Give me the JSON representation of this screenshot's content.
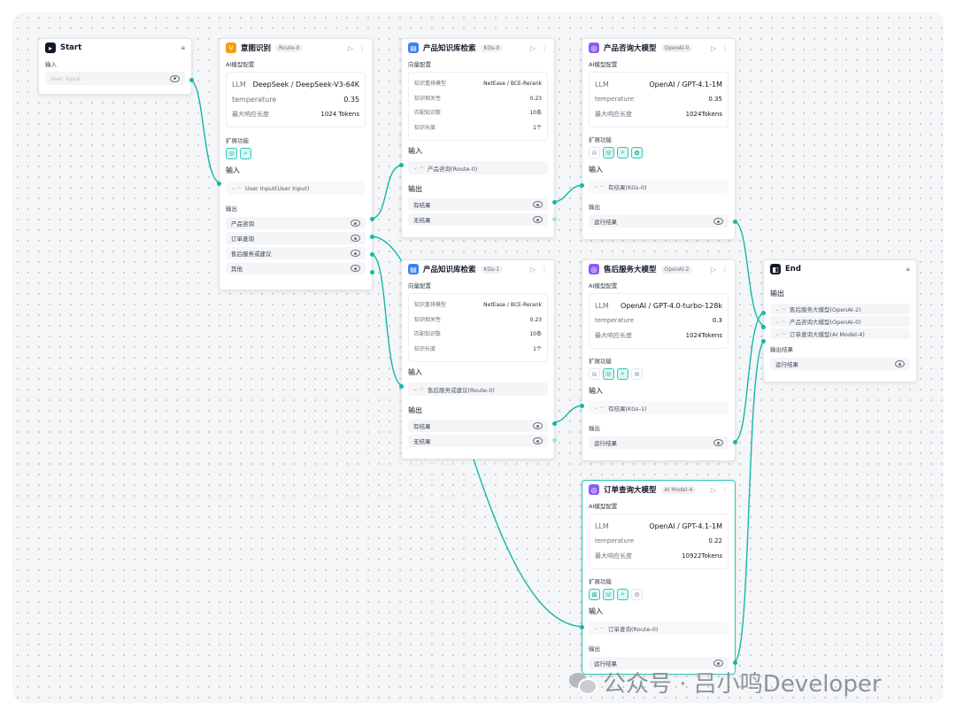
{
  "nodes": {
    "start": {
      "title": "Start",
      "input_label": "输入",
      "input_placeholder": "User Input"
    },
    "route": {
      "title": "意图识别",
      "badge": "Route-0",
      "config_label": "AI模型配置",
      "llm_label": "LLM",
      "llm_value": "DeepSeek / DeepSeek-V3-64K",
      "temp_label": "temperature",
      "temp_value": "0.35",
      "maxlen_label": "最大响应长度",
      "maxlen_value": "1024 Tokens",
      "ext_label": "扩展功能",
      "input_label": "输入",
      "input_value": "User Input(User Input)",
      "output_label": "输出",
      "outputs": [
        "产品咨询",
        "订单查询",
        "售后服务或建议",
        "其他"
      ]
    },
    "kb0": {
      "title": "产品知识库检索",
      "badge": "KGs-0",
      "config_label": "向量配置",
      "rows": [
        [
          "知识重排模型",
          "NetEase / BCE-Rerank"
        ],
        [
          "知识相关性",
          "0.23"
        ],
        [
          "匹配知识数",
          "10条"
        ],
        [
          "知识长度",
          "1个"
        ]
      ],
      "input_label": "输入",
      "input_value": "产品咨询(Route-0)",
      "output_label": "输出",
      "outputs": [
        "有结果",
        "无结果"
      ]
    },
    "kb1": {
      "title": "产品知识库检索",
      "badge": "KGs-1",
      "config_label": "向量配置",
      "rows": [
        [
          "知识重排模型",
          "NetEase / BCE-Rerank"
        ],
        [
          "知识相关性",
          "0.23"
        ],
        [
          "匹配知识数",
          "10条"
        ],
        [
          "知识长度",
          "1个"
        ]
      ],
      "input_label": "输入",
      "input_value": "售后服务或建议(Route-0)",
      "output_label": "输出",
      "outputs": [
        "有结果",
        "无结果"
      ]
    },
    "llm0": {
      "title": "产品咨询大模型",
      "badge": "OpenAI-0",
      "config_label": "AI模型配置",
      "llm_label": "LLM",
      "llm_value": "OpenAI / GPT-4.1-1M",
      "temp_label": "temperature",
      "temp_value": "0.35",
      "maxlen_label": "最大响应长度",
      "maxlen_value": "1024Tokens",
      "ext_label": "扩展功能",
      "input_label": "输入",
      "input_value": "有结果(KGs-0)",
      "output_label": "输出",
      "output": "运行结果"
    },
    "llm2": {
      "title": "售后服务大模型",
      "badge": "OpenAI-2",
      "config_label": "AI模型配置",
      "llm_label": "LLM",
      "llm_value": "OpenAI / GPT-4.0-turbo-128k",
      "temp_label": "temperature",
      "temp_value": "0.3",
      "maxlen_label": "最大响应长度",
      "maxlen_value": "1024Tokens",
      "ext_label": "扩展功能",
      "input_label": "输入",
      "input_value": "有结果(KGs-1)",
      "output_label": "输出",
      "output": "运行结果"
    },
    "llm4": {
      "title": "订单查询大模型",
      "badge": "AI Model-4",
      "config_label": "AI模型配置",
      "llm_label": "LLM",
      "llm_value": "OpenAI / GPT-4.1-1M",
      "temp_label": "temperature",
      "temp_value": "0.22",
      "maxlen_label": "最大响应长度",
      "maxlen_value": "10922Tokens",
      "ext_label": "扩展功能",
      "input_label": "输入",
      "input_value": "订单查询(Route-0)",
      "output_label": "输出",
      "output": "运行结果"
    },
    "end": {
      "title": "End",
      "output_label": "输出",
      "outputs": [
        "售后服务大模型(OpenAI-2)",
        "产品咨询大模型(OpenAI-0)",
        "订单查询大模型(AI Model-4)"
      ],
      "result_label": "输出结果",
      "result_value": "运行结果"
    }
  },
  "watermark": {
    "text": "公众号 · 吕小鸣Developer"
  },
  "colors": {
    "accent": "#14b8a6",
    "route_icon": "#f59e0b",
    "kb_icon": "#3b82f6",
    "llm_icon": "#8b5cf6",
    "dark_icon": "#111827"
  }
}
